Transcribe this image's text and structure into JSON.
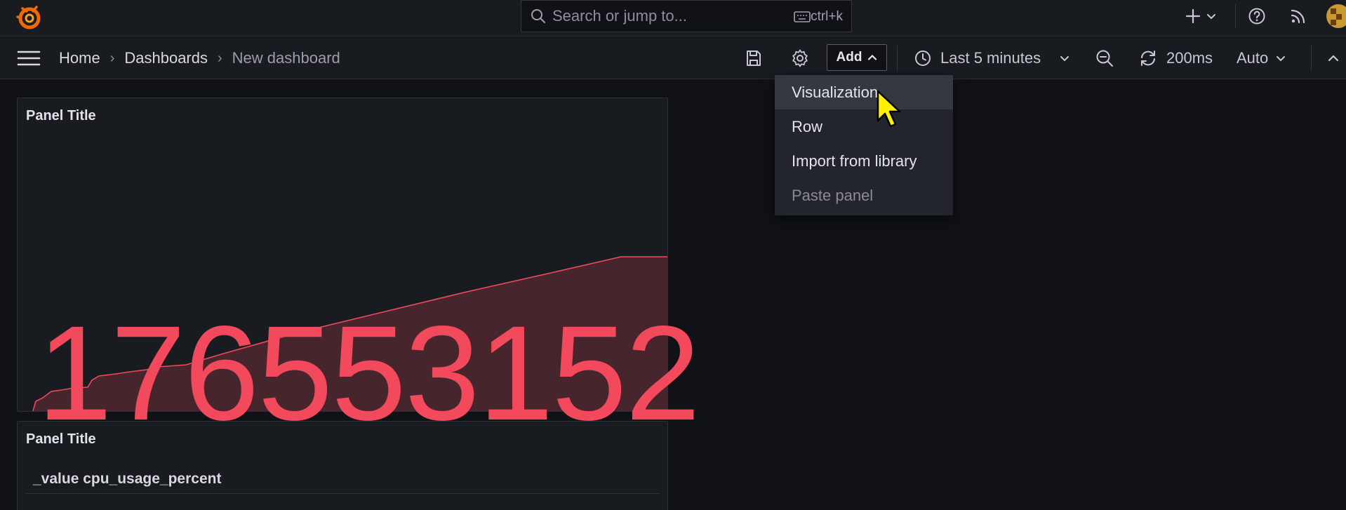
{
  "search": {
    "placeholder": "Search or jump to...",
    "shortcut": "ctrl+k"
  },
  "breadcrumb": [
    "Home",
    "Dashboards",
    "New dashboard"
  ],
  "toolbar": {
    "add_label": "Add",
    "time_range": "Last 5 minutes",
    "refresh_interval": "200ms",
    "auto_label": "Auto"
  },
  "add_menu": {
    "items": [
      {
        "label": "Visualization",
        "state": "hover"
      },
      {
        "label": "Row",
        "state": "normal"
      },
      {
        "label": "Import from library",
        "state": "normal"
      },
      {
        "label": "Paste panel",
        "state": "disabled"
      }
    ]
  },
  "panels": [
    {
      "title": "Panel Title",
      "value": "176553152",
      "color": "#f2495c"
    },
    {
      "title": "Panel Title",
      "column_header": "_value cpu_usage_percent"
    }
  ],
  "colors": {
    "accent": "#f2495c",
    "background": "#111217",
    "surface": "#181b1f",
    "grafana_orange": "#f46800"
  },
  "icons": [
    "grafana-logo-icon",
    "search-icon",
    "keyboard-icon",
    "plus-icon",
    "chevron-down-icon",
    "help-icon",
    "rss-icon",
    "menu-icon",
    "save-icon",
    "gear-icon",
    "clock-icon",
    "zoom-out-icon",
    "refresh-icon",
    "chevron-up-icon",
    "cursor-icon"
  ]
}
